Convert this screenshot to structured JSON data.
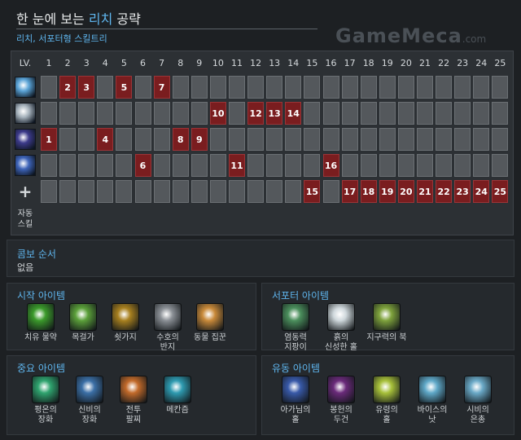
{
  "header": {
    "title_prefix": "한 눈에 보는 ",
    "title_highlight": "리치",
    "title_suffix": " 공략",
    "subtitle": "리치, 서포터형 스킬트리",
    "watermark_main": "GameMeca",
    "watermark_tld": ".com"
  },
  "skill_grid": {
    "header_label": "LV.",
    "levels": [
      "1",
      "2",
      "3",
      "4",
      "5",
      "6",
      "7",
      "8",
      "9",
      "10",
      "11",
      "12",
      "13",
      "14",
      "15",
      "16",
      "17",
      "18",
      "19",
      "20",
      "21",
      "22",
      "23",
      "24",
      "25"
    ],
    "rows": [
      {
        "icon": "ice-shard-icon",
        "color": "#5aa3d6",
        "levels": [
          2,
          3,
          5,
          7
        ]
      },
      {
        "icon": "frost-armor-icon",
        "color": "#a8b4be",
        "levels": [
          10,
          12,
          13,
          14
        ]
      },
      {
        "icon": "sacrifice-icon",
        "color": "#3c3a8a",
        "levels": [
          1,
          4,
          8,
          9
        ]
      },
      {
        "icon": "chain-frost-icon",
        "color": "#3d63b8",
        "levels": [
          6,
          11,
          16
        ]
      },
      {
        "icon": "plus-icon",
        "glyph": "+",
        "levels": [
          15,
          17,
          18,
          19,
          20,
          21,
          22,
          23,
          24,
          25
        ]
      }
    ],
    "auto_label_line1": "자동",
    "auto_label_line2": "스킬"
  },
  "combo": {
    "label": "콤보 순서",
    "value": "없음"
  },
  "panels": {
    "start_items": {
      "title": "시작 아이템",
      "items": [
        {
          "name_l1": "치유 물약",
          "name_l2": "",
          "icon": "healing-salve-icon",
          "color": "#3b9a2b"
        },
        {
          "name_l1": "목걸가",
          "name_l2": "",
          "icon": "tango-icon",
          "color": "#5ba03a"
        },
        {
          "name_l1": "쇳가지",
          "name_l2": "",
          "icon": "iron-branch-icon",
          "color": "#a8801f"
        },
        {
          "name_l1": "수호의",
          "name_l2": "반지",
          "icon": "ring-icon",
          "color": "#8a8f95"
        },
        {
          "name_l1": "동물 집꾼",
          "name_l2": "",
          "icon": "courier-icon",
          "color": "#c98a3a"
        }
      ]
    },
    "support_items": {
      "title": "서포터 아이템",
      "items": [
        {
          "name_l1": "염동력",
          "name_l2": "지팡이",
          "icon": "force-staff-icon",
          "color": "#4b8f5c"
        },
        {
          "name_l1": "흙의",
          "name_l2": "신성한 홀",
          "icon": "mekansm-icon",
          "color": "#cfd8dc"
        },
        {
          "name_l1": "지구력의 북",
          "name_l2": "",
          "icon": "drum-icon",
          "color": "#7ea23c"
        }
      ]
    },
    "core_items": {
      "title": "중요 아이템",
      "items": [
        {
          "name_l1": "평온의",
          "name_l2": "장화",
          "icon": "tranquil-boots-icon",
          "color": "#2fa36e"
        },
        {
          "name_l1": "신비의",
          "name_l2": "장화",
          "icon": "arcane-boots-icon",
          "color": "#3b6fa6"
        },
        {
          "name_l1": "전투",
          "name_l2": "팔찌",
          "icon": "bracer-icon",
          "color": "#c26a2a"
        },
        {
          "name_l1": "메칸즘",
          "name_l2": "",
          "icon": "mekansm-kit-icon",
          "color": "#2e9ab0"
        }
      ]
    },
    "flex_items": {
      "title": "유동 아이템",
      "items": [
        {
          "name_l1": "아가님의",
          "name_l2": "홀",
          "icon": "scepter-icon",
          "color": "#3859a8"
        },
        {
          "name_l1": "봉헌의",
          "name_l2": "두건",
          "icon": "hood-icon",
          "color": "#6a2a7a"
        },
        {
          "name_l1": "유령의",
          "name_l2": "홀",
          "icon": "ghost-scepter-icon",
          "color": "#a7c03a"
        },
        {
          "name_l1": "바이스의",
          "name_l2": "낫",
          "icon": "scythe-icon",
          "color": "#5fa8c8"
        },
        {
          "name_l1": "시비의",
          "name_l2": "은총",
          "icon": "shivas-icon",
          "color": "#6aa9c7"
        }
      ]
    }
  }
}
